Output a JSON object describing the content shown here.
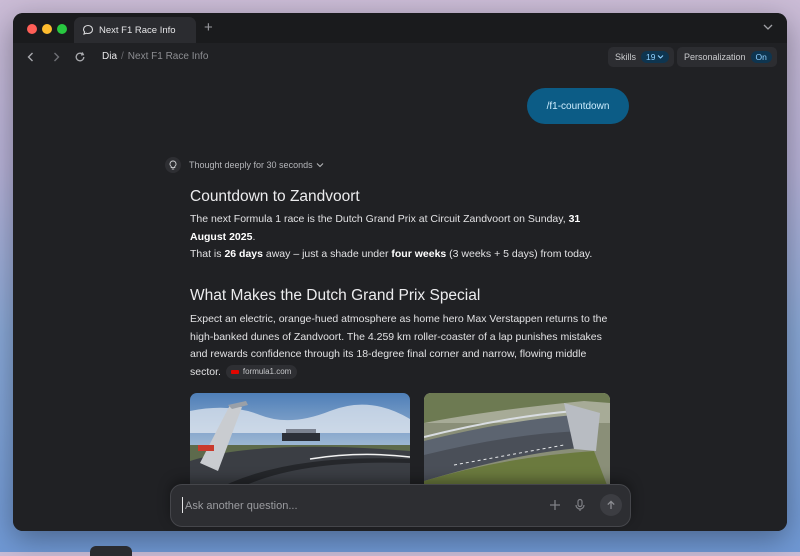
{
  "window": {
    "tab_title": "Next F1 Race Info"
  },
  "toolbar": {
    "breadcrumb_root": "Dia",
    "breadcrumb_separator": "/",
    "breadcrumb_page": "Next F1 Race Info",
    "skills_label": "Skills",
    "skills_count": "19",
    "personalization_label": "Personalization",
    "personalization_state": "On"
  },
  "chat": {
    "user_message": "/f1-countdown",
    "thought_label": "Thought deeply for 30 seconds",
    "section1": {
      "title": "Countdown to Zandvoort",
      "line1_pre": "The next Formula 1 race is the Dutch Grand Prix at Circuit Zandvoort on Sunday, ",
      "line1_bold": "31 August 2025",
      "line1_post": ".",
      "line2_pre": "That is ",
      "line2_bold1": "26 days",
      "line2_mid": " away – just a shade under ",
      "line2_bold2": "four weeks",
      "line2_post": " (3 weeks + 5 days) from today."
    },
    "section2": {
      "title": "What Makes the Dutch Grand Prix Special",
      "body": "Expect an electric, orange-hued atmosphere as home hero Max Verstappen returns to the high-banked dunes of Zandvoort. The 4.259 km roller-coaster of a lap punishes mistakes and rewards confidence through its 18-degree final corner and narrow, flowing middle sector.",
      "source": "formula1.com"
    }
  },
  "input": {
    "placeholder": "Ask another question..."
  },
  "colors": {
    "user_bubble": "#0c5c86",
    "badge_text": "#8fd0ff",
    "background": "#202124"
  },
  "icons": [
    "chat-bubble-icon",
    "plus-icon",
    "chevron-down-icon",
    "back-icon",
    "forward-icon",
    "reload-icon",
    "lightbulb-icon",
    "mic-icon",
    "send-arrow-icon",
    "f1-logo-icon"
  ]
}
